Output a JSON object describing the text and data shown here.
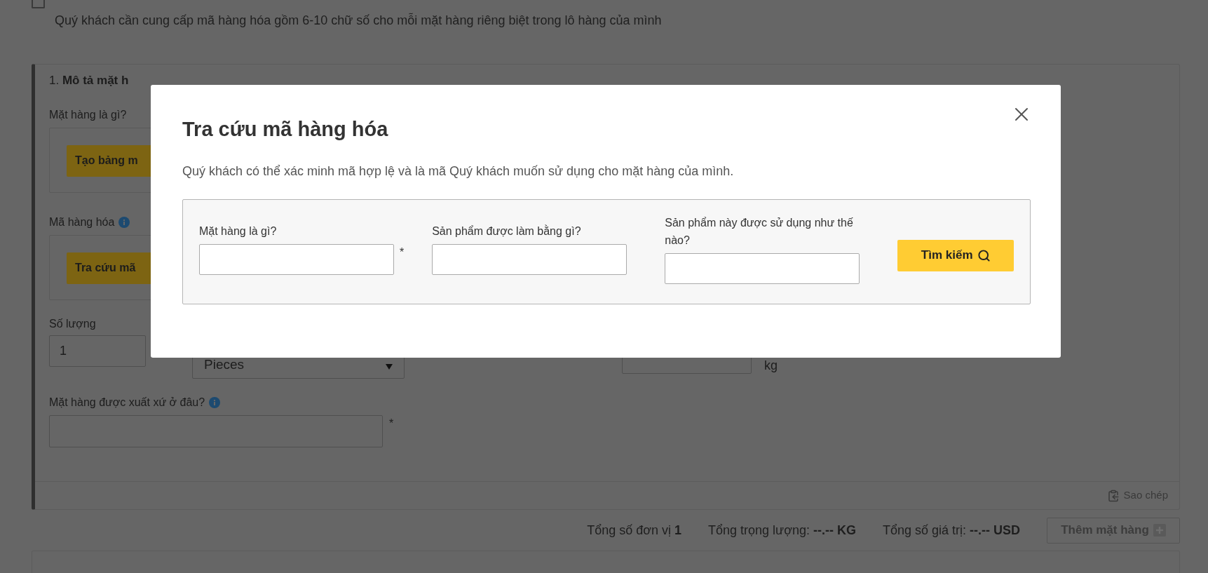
{
  "consent": {
    "checked": false
  },
  "hint": "Quý khách cần cung cấp mã hàng hóa gồm 6-10 chữ số cho mỗi mặt hàng riêng biệt trong lô hàng của mình",
  "item_card": {
    "heading": "1. **Mô tả mặt h**",
    "sections": [
      {
        "label": "Mặt hàng là gì?",
        "info": false,
        "button": "Tạo bảng m"
      },
      {
        "label": "Mã hàng hóa",
        "info": true,
        "button": "Tra cứu mã"
      }
    ],
    "quantity": {
      "label": "Số lượng",
      "value": "1"
    },
    "unit": {
      "value": "Pieces"
    },
    "weight_unit": "kg",
    "origin": {
      "label": "Mặt hàng được xuất xứ ở đâu?",
      "info": true,
      "required_mark": "*"
    },
    "copy_link": "Sao chép"
  },
  "totals": [
    "Tổng số đơn vị **1**",
    "Tổng trọng lượng: **--.-- KG**",
    "Tổng số giá trị: **--.-- USD**"
  ],
  "add_button": {
    "label": "Thêm mặt hàng",
    "disabled": true
  },
  "modal": {
    "title": "Tra cứu mã hàng hóa",
    "description": "Quý khách có thể xác minh mã hợp lệ và là mã Quý khách muốn sử dụng cho mặt hàng của mình.",
    "fields": [
      {
        "label": "Mặt hàng là gì?",
        "required_mark": "*"
      },
      {
        "label": "Sản phẩm được làm bằng gì?"
      },
      {
        "label": "Sản phẩm này được sử dụng như thế nào?"
      }
    ],
    "search_button": "Tìm kiếm"
  }
}
